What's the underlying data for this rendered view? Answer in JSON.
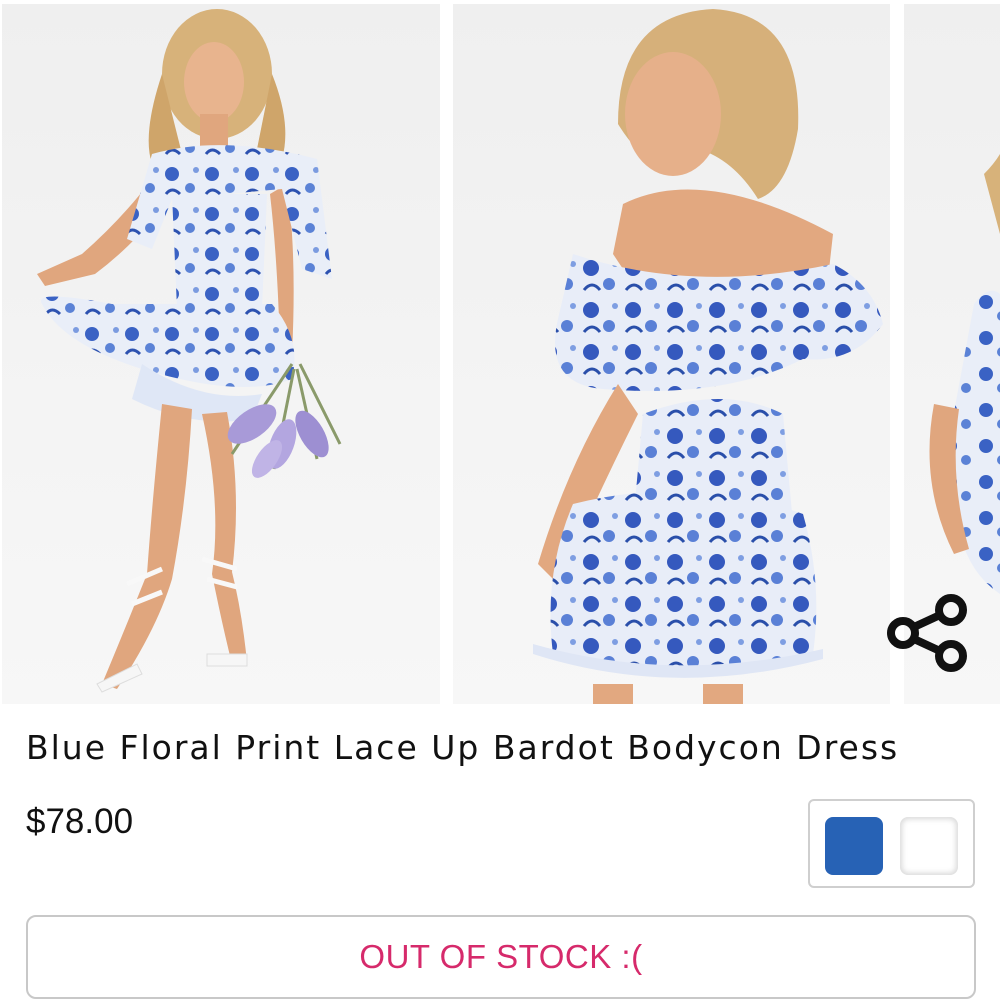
{
  "gallery": {
    "images": [
      {
        "name": "Front view of model in blue floral off-shoulder dress holding lavender"
      },
      {
        "name": "Back view of model in blue floral off-shoulder dress"
      },
      {
        "name": "Partial side view of model"
      }
    ],
    "share_icon": "share-icon"
  },
  "product": {
    "title": "Blue Floral Print Lace Up Bardot Bodycon Dress",
    "price": "$78.00",
    "swatches": [
      {
        "name": "blue",
        "color": "#2762b5"
      },
      {
        "name": "white",
        "color": "#ffffff"
      }
    ]
  },
  "actions": {
    "stock_label": "OUT OF STOCK :("
  },
  "colors": {
    "accent": "#d62a6b",
    "border": "#c8c8c8",
    "dress_blue": "#2f5fc0"
  }
}
